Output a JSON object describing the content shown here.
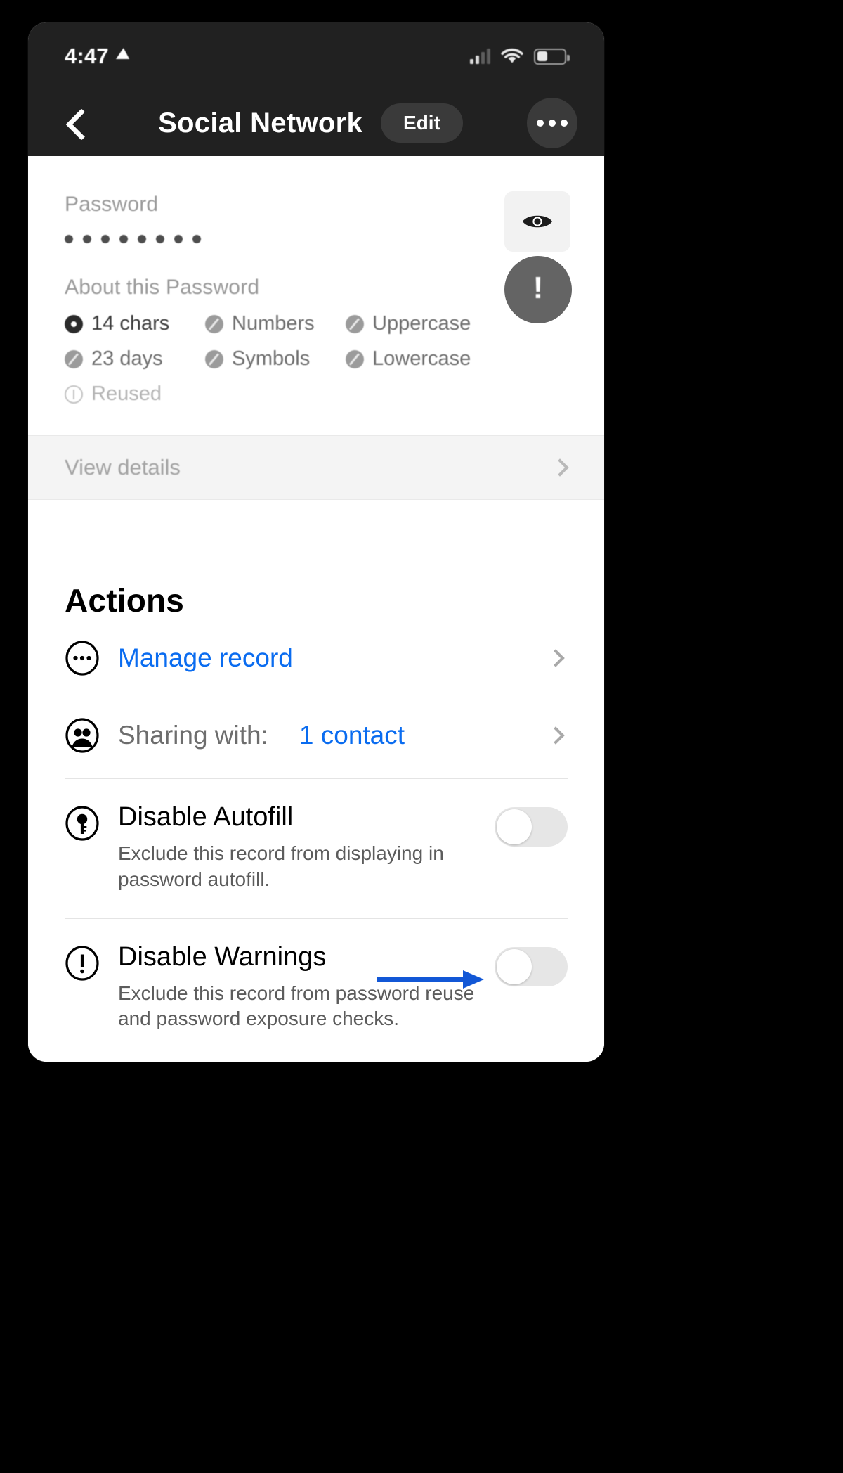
{
  "status_bar": {
    "time": "4:47",
    "location_icon": "location-arrow-icon",
    "cellular_icon": "cellular-signal-icon",
    "wifi_icon": "wifi-icon",
    "battery_icon": "battery-icon"
  },
  "nav": {
    "back_icon": "back-chevron-icon",
    "title": "Social Network",
    "edit_label": "Edit",
    "more_icon": "more-options-icon"
  },
  "password_section": {
    "label": "Password",
    "masked_value": "••••••••",
    "dot_count": 8,
    "reveal_icon": "eye-icon"
  },
  "about_section": {
    "title": "About this Password",
    "chips": [
      {
        "label": "14 chars",
        "icon": "filled-dot-icon",
        "state": "dark"
      },
      {
        "label": "Numbers",
        "icon": "slashed-circle-icon",
        "state": "gray"
      },
      {
        "label": "Uppercase",
        "icon": "slashed-circle-icon",
        "state": "gray"
      },
      {
        "label": "23 days",
        "icon": "slashed-circle-icon",
        "state": "gray"
      },
      {
        "label": "Symbols",
        "icon": "slashed-circle-icon",
        "state": "gray"
      },
      {
        "label": "Lowercase",
        "icon": "slashed-circle-icon",
        "state": "gray"
      },
      {
        "label": "Reused",
        "icon": "warning-circle-icon",
        "state": "muted"
      }
    ],
    "alert_badge": {
      "icon": "exclamation-icon",
      "glyph": "!",
      "color": "#646464"
    }
  },
  "view_details": {
    "label": "View details",
    "chevron_icon": "chevron-right-icon"
  },
  "actions": {
    "title": "Actions",
    "rows": [
      {
        "label": "Manage record",
        "icon": "ellipsis-circle-icon",
        "chevron_icon": "chevron-right-icon"
      },
      {
        "label": "Sharing with:",
        "value": "1 contact",
        "icon": "contacts-circle-icon",
        "chevron_icon": "chevron-right-icon"
      }
    ],
    "toggles": [
      {
        "title": "Disable Autofill",
        "subtitle": "Exclude this record from displaying in password autofill.",
        "icon": "key-circle-icon",
        "state": "off"
      },
      {
        "title": "Disable Warnings",
        "subtitle": "Exclude this record from password reuse and password exposure checks.",
        "icon": "exclamation-circle-icon",
        "state": "off"
      }
    ]
  },
  "annotation": {
    "arrow_icon": "annotation-arrow-icon",
    "color": "#1257d6",
    "points_to": "Disable Warnings toggle"
  },
  "colors": {
    "accent_blue": "#0a6cf0",
    "header_dark": "#212121",
    "page_background": "#000000",
    "card_background": "#ffffff",
    "band_gray": "#f4f4f4"
  }
}
